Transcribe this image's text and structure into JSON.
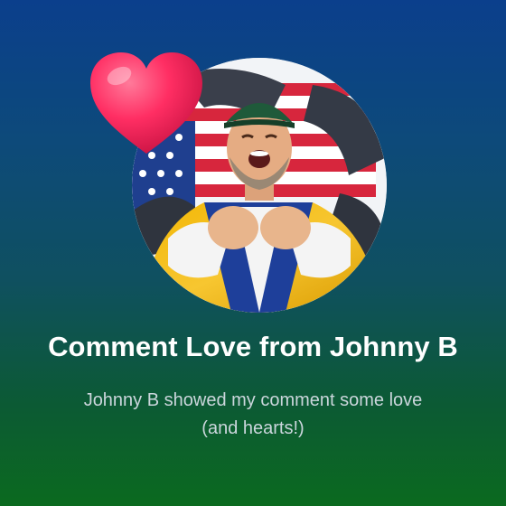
{
  "card": {
    "title": "Comment Love from Johnny B",
    "description": "Johnny B showed my comment some love (and hearts!)"
  },
  "icons": {
    "heart": "heart-icon",
    "avatar": "profile-avatar"
  },
  "colors": {
    "background_top": "#0b3f8c",
    "background_bottom": "#0b6a1f",
    "heart": "#ff2e63",
    "title_text": "#ffffff",
    "subtitle_text": "#cbd6dc"
  }
}
